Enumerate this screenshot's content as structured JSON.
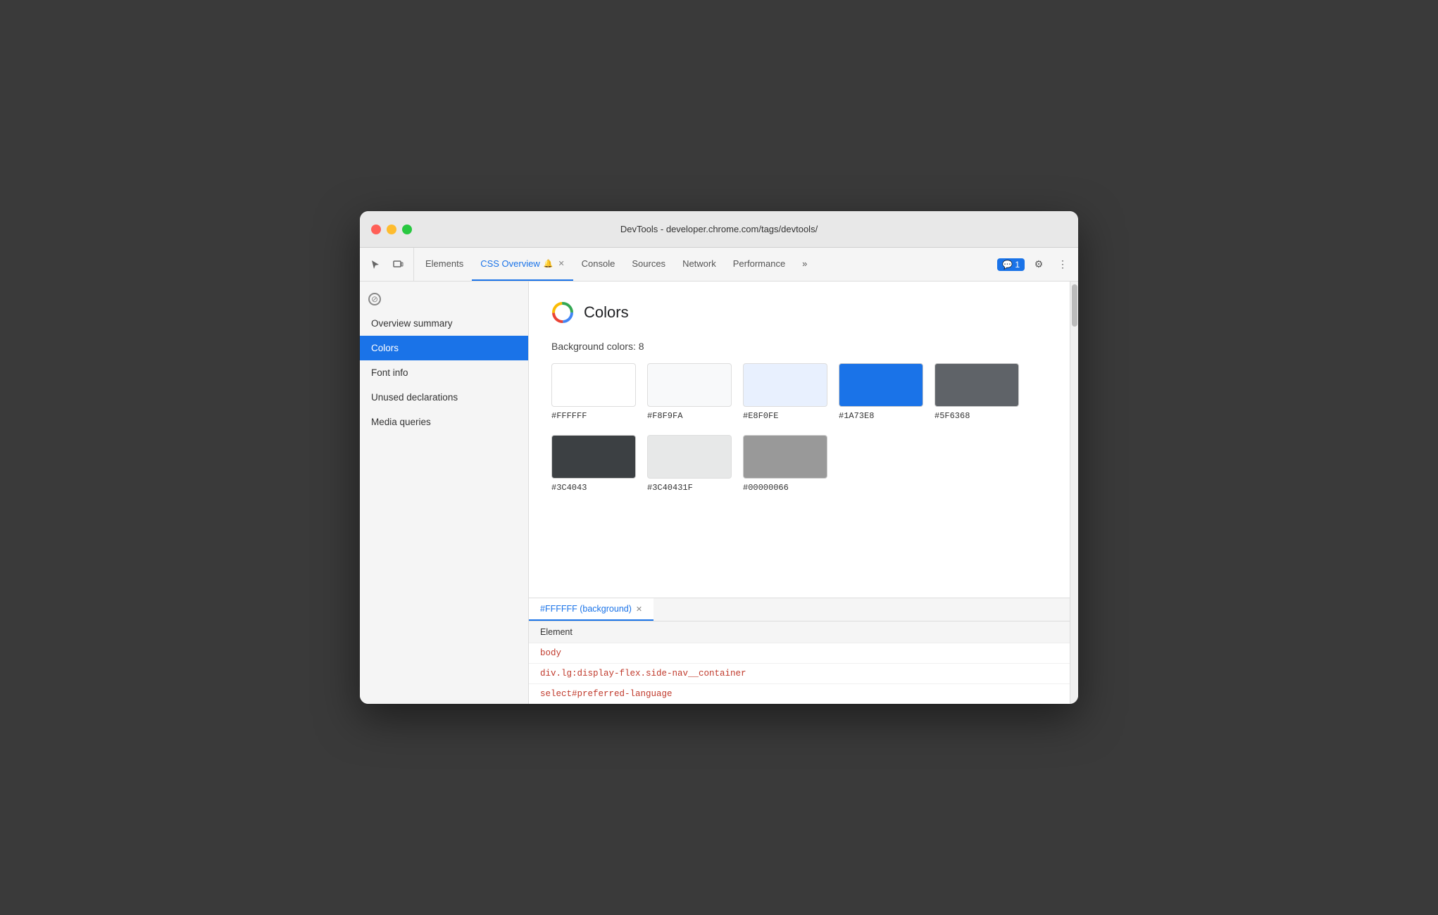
{
  "window": {
    "title": "DevTools - developer.chrome.com/tags/devtools/"
  },
  "toolbar": {
    "tabs": [
      {
        "id": "elements",
        "label": "Elements",
        "active": false
      },
      {
        "id": "css-overview",
        "label": "CSS Overview",
        "active": true,
        "warning": true,
        "closeable": true
      },
      {
        "id": "console",
        "label": "Console",
        "active": false
      },
      {
        "id": "sources",
        "label": "Sources",
        "active": false
      },
      {
        "id": "network",
        "label": "Network",
        "active": false
      },
      {
        "id": "performance",
        "label": "Performance",
        "active": false
      },
      {
        "id": "more",
        "label": "»",
        "active": false
      }
    ],
    "chat_badge": "1",
    "settings_icon": "⚙",
    "more_icon": "⋮"
  },
  "sidebar": {
    "items": [
      {
        "id": "overview-summary",
        "label": "Overview summary",
        "active": false
      },
      {
        "id": "colors",
        "label": "Colors",
        "active": true
      },
      {
        "id": "font-info",
        "label": "Font info",
        "active": false
      },
      {
        "id": "unused-declarations",
        "label": "Unused declarations",
        "active": false
      },
      {
        "id": "media-queries",
        "label": "Media queries",
        "active": false
      }
    ]
  },
  "colors_panel": {
    "title": "Colors",
    "background_colors_label": "Background colors: 8",
    "swatches": [
      {
        "id": "ffffff",
        "color": "#FFFFFF",
        "label": "#FFFFFF",
        "border": true
      },
      {
        "id": "f8f9fa",
        "color": "#F8F9FA",
        "label": "#F8F9FA",
        "border": true
      },
      {
        "id": "e8f0fe",
        "color": "#E8F0FE",
        "label": "#E8F0FE",
        "border": false
      },
      {
        "id": "1a73e8",
        "color": "#1A73E8",
        "label": "#1A73E8",
        "border": false
      },
      {
        "id": "5f6368",
        "color": "#5F6368",
        "label": "#5F6368",
        "border": false
      },
      {
        "id": "3c4043",
        "color": "#3C4043",
        "label": "#3C4043",
        "border": false
      },
      {
        "id": "3c40431f",
        "color": "rgba(60,64,67,0.12)",
        "label": "#3C40431F",
        "border": true
      },
      {
        "id": "00000066",
        "color": "rgba(0,0,0,0.4)",
        "label": "#00000066",
        "border": false
      }
    ]
  },
  "bottom_panel": {
    "tab_label": "#FFFFFF (background)",
    "element_header": "Element",
    "elements": [
      {
        "text": "body",
        "class": "tag-red"
      },
      {
        "text": "div.lg:display-flex.side-nav__container",
        "class": "tag-red"
      },
      {
        "text": "select#preferred-language",
        "class": "tag-red"
      }
    ]
  }
}
